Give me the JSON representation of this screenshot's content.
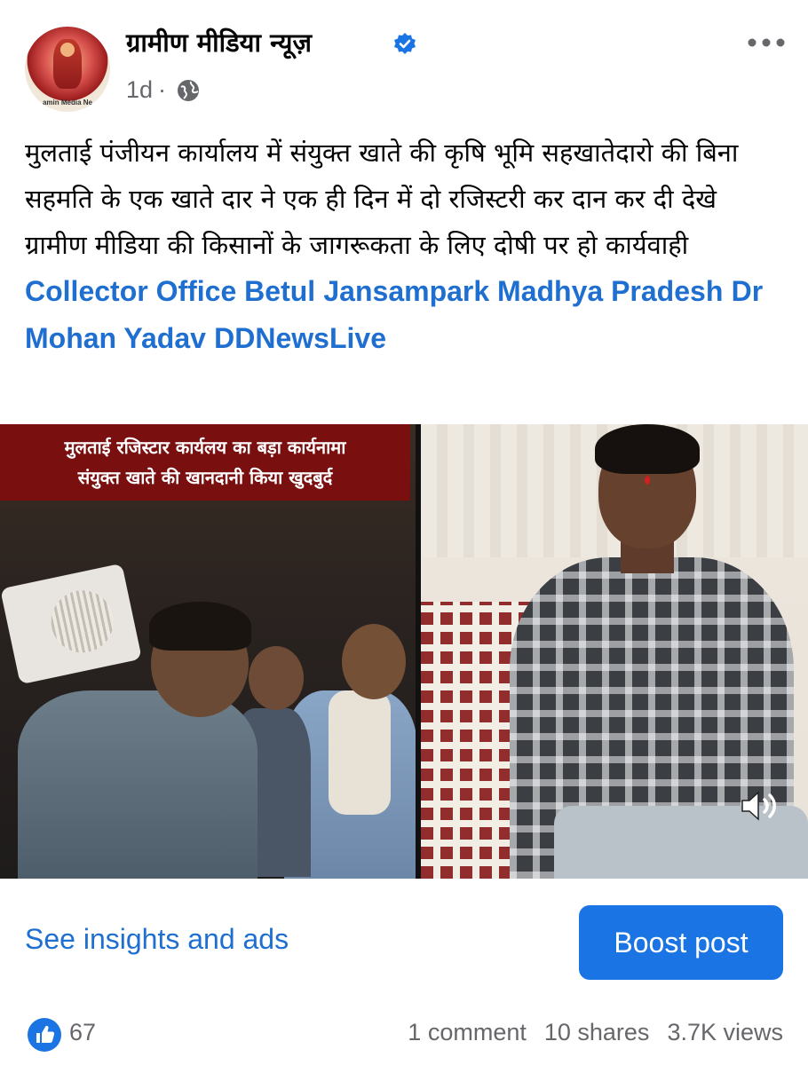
{
  "post": {
    "page_name": "ग्रामीण मीडिया न्यूज़",
    "avatar_caption": "amin Media Ne",
    "time_ago": "1d",
    "separator": "·",
    "body_text": "मुलताई पंजीयन कार्यालय में संयुक्त खाते की कृषि भूमि सहखातेदारो की बिना सहमति के एक खाते दार ने एक ही दिन में दो रजिस्टरी कर दान कर दी देखे ग्रामीण मीडिया की किसानों के जागरूकता के लिए दोषी पर हो कार्यवाही",
    "tags": [
      {
        "label": "Collector Office Betul"
      },
      {
        "label": "Jansampark Madhya Pradesh"
      },
      {
        "label": "Dr Mohan Yadav"
      },
      {
        "label": "DDNewsLive"
      }
    ]
  },
  "media": {
    "overlay_line1": "मुलताई रजिस्टार कार्यलय का बड़ा कार्यनामा",
    "overlay_line2": "संयुक्त खाते की खानदानी किया खुदबुर्द",
    "icons": [
      "volume-icon"
    ]
  },
  "actions": {
    "insights_label": "See insights and ads",
    "boost_label": "Boost post"
  },
  "footer": {
    "like_count": "67",
    "comments": "1 comment",
    "shares": "10 shares",
    "views": "3.7K views"
  },
  "colors": {
    "link": "#1f6fd1",
    "boost_bg": "#1b74e4",
    "muted": "#65676b",
    "banner": "#7a0f0f"
  }
}
